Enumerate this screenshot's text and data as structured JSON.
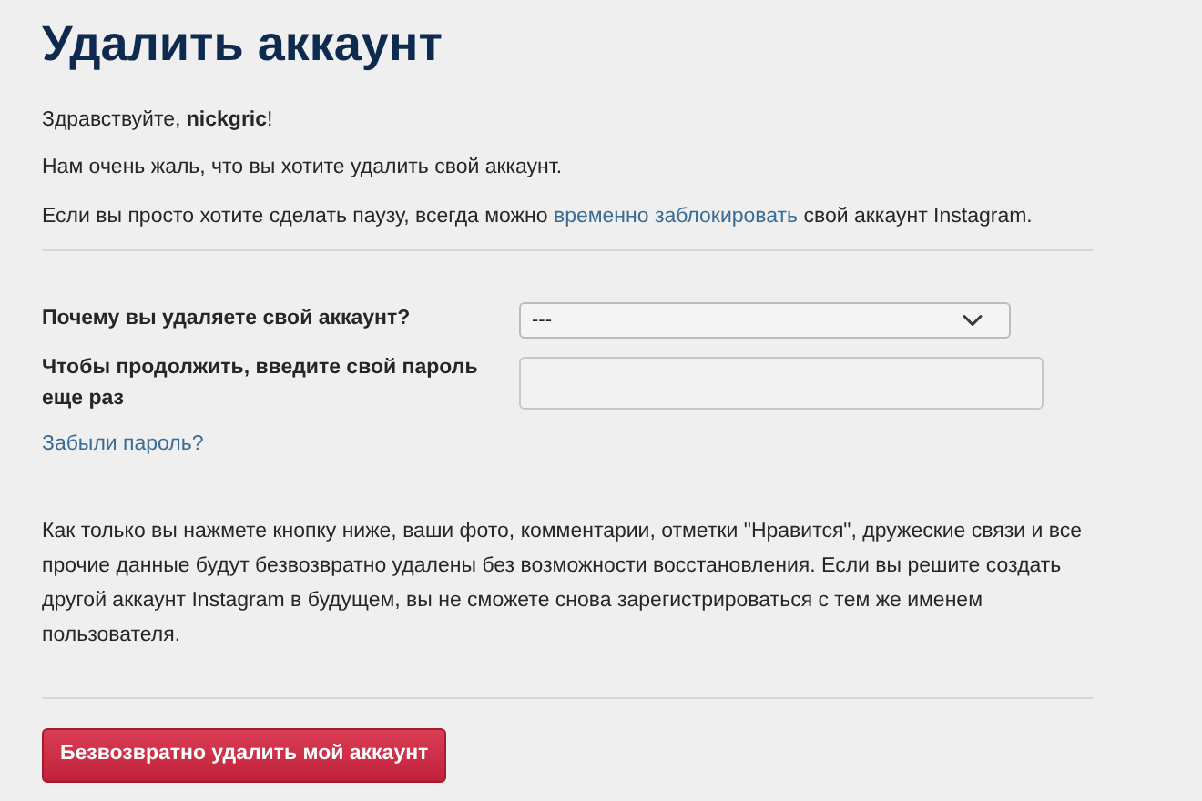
{
  "title": "Удалить аккаунт",
  "greeting": "Здравствуйте, **nickgric**!",
  "sorry_text": "Нам очень жаль, что вы хотите удалить свой аккаунт.",
  "pause_text": {
    "before": "Если вы просто хотите сделать паузу, всегда можно",
    "link": "временно заблокировать",
    "after": "свой аккаунт Instagram."
  },
  "reason": {
    "label": "Почему вы удаляете свой аккаунт?",
    "value": "---"
  },
  "password": {
    "label": "Чтобы продолжить, введите свой пароль еще раз"
  },
  "forgot_link": "Забыли пароль?",
  "warning": "Как только вы нажмете кнопку ниже, ваши фото, комментарии, отметки \"Нравится\", дружеские связи и все прочие данные будут безвозвратно удалены без возможности восстановления. Если вы решите создать другой аккаунт Instagram в будущем, вы не сможете снова зарегистрироваться с тем же именем пользователя.",
  "delete_button": "Безвозвратно удалить мой аккаунт"
}
